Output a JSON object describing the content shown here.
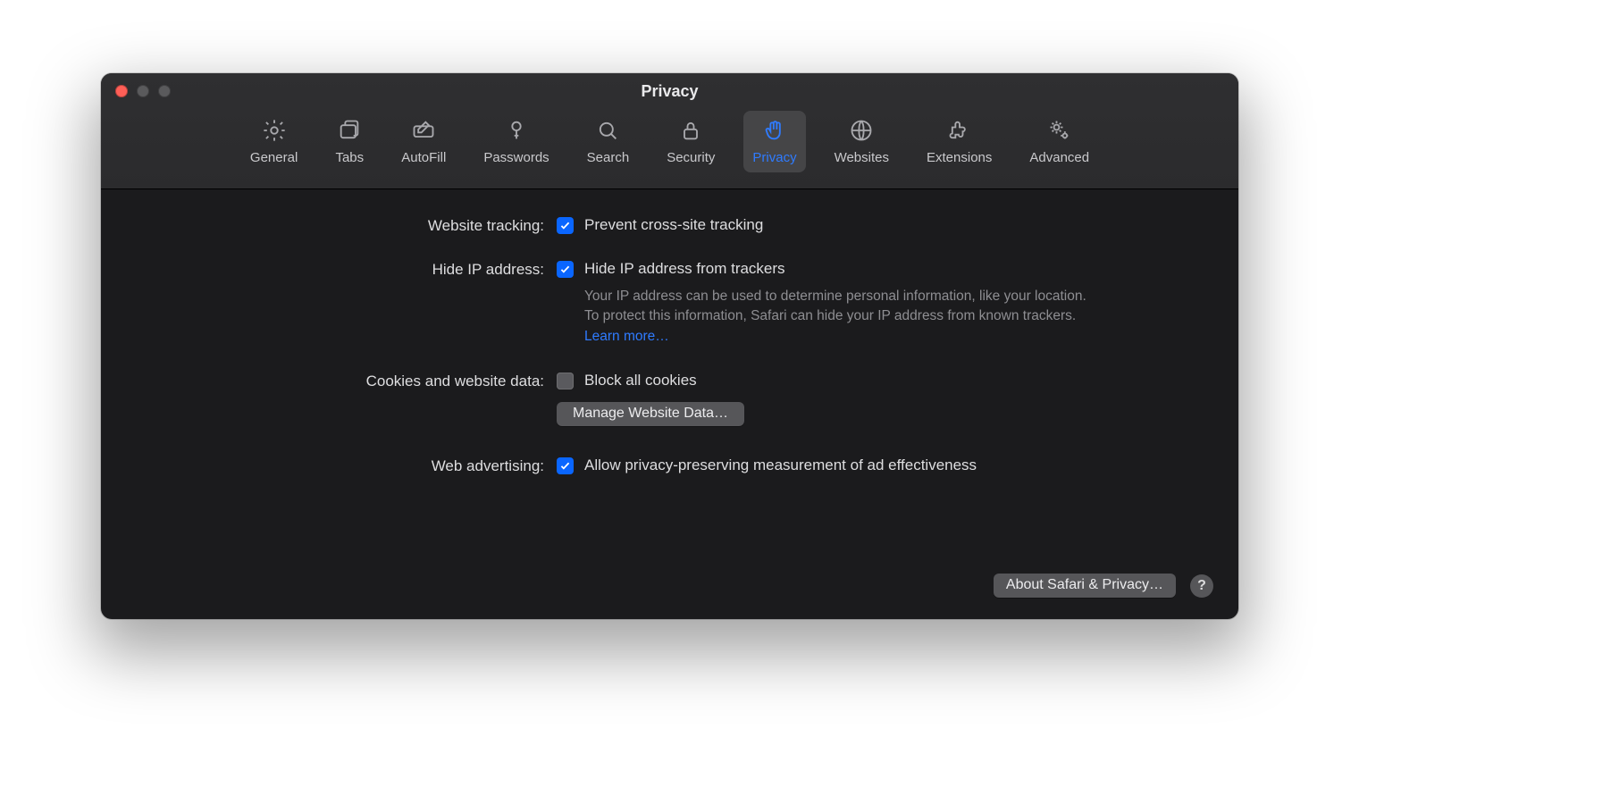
{
  "window_title": "Privacy",
  "tabs": [
    {
      "id": "general",
      "label": "General"
    },
    {
      "id": "tabs",
      "label": "Tabs"
    },
    {
      "id": "autofill",
      "label": "AutoFill"
    },
    {
      "id": "passwords",
      "label": "Passwords"
    },
    {
      "id": "search",
      "label": "Search"
    },
    {
      "id": "security",
      "label": "Security"
    },
    {
      "id": "privacy",
      "label": "Privacy",
      "active": true
    },
    {
      "id": "websites",
      "label": "Websites"
    },
    {
      "id": "extensions",
      "label": "Extensions"
    },
    {
      "id": "advanced",
      "label": "Advanced"
    }
  ],
  "sections": {
    "website_tracking_label": "Website tracking:",
    "prevent_cross_site": "Prevent cross-site tracking",
    "hide_ip_label": "Hide IP address:",
    "hide_ip_option": "Hide IP address from trackers",
    "hide_ip_desc": "Your IP address can be used to determine personal information, like your location. To protect this information, Safari can hide your IP address from known trackers. ",
    "learn_more": "Learn more…",
    "cookies_label": "Cookies and website data:",
    "block_all_cookies": "Block all cookies",
    "manage_button": "Manage Website Data…",
    "web_adv_label": "Web advertising:",
    "web_adv_option": "Allow privacy-preserving measurement of ad effectiveness",
    "about_button": "About Safari & Privacy…",
    "help_symbol": "?"
  },
  "checkbox_states": {
    "prevent_cross_site": true,
    "hide_ip": true,
    "block_cookies": false,
    "web_adv": true
  }
}
